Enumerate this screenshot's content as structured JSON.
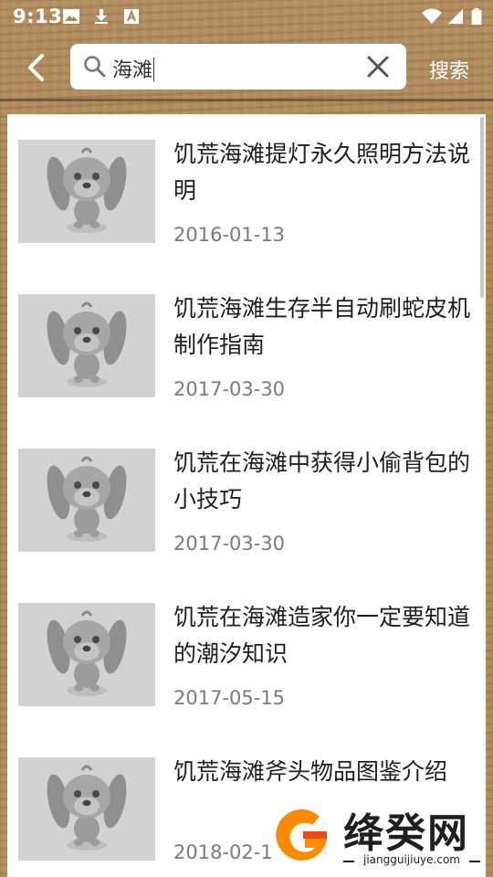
{
  "status_bar": {
    "time": "9:13",
    "left_icons": [
      "image-icon",
      "download-icon",
      "font-icon"
    ],
    "right_icons": [
      "wifi-icon",
      "signal-icon",
      "battery-icon"
    ]
  },
  "app_bar": {
    "back_icon": "chevron-left-icon",
    "search": {
      "value": "海滩",
      "placeholder": ""
    },
    "clear_icon": "close-icon",
    "search_button_label": "搜索"
  },
  "results": [
    {
      "title": "饥荒海滩提灯永久照明方法说明",
      "date": "2016-01-13"
    },
    {
      "title": "饥荒海滩生存半自动刷蛇皮机制作指南",
      "date": "2017-03-30"
    },
    {
      "title": "饥荒在海滩中获得小偷背包的小技巧",
      "date": "2017-03-30"
    },
    {
      "title": "饥荒在海滩造家你一定要知道的潮汐知识",
      "date": "2017-05-15"
    },
    {
      "title": "饥荒海滩斧头物品图鉴介绍",
      "date": "2018-02-1"
    }
  ],
  "watermark": {
    "name": "绛癸网",
    "url": "jiangguijiuye.com"
  },
  "colors": {
    "accent": "#ff8800",
    "text": "#1e1e1e",
    "date": "#7b7b7b",
    "panel": "#ffffff"
  }
}
